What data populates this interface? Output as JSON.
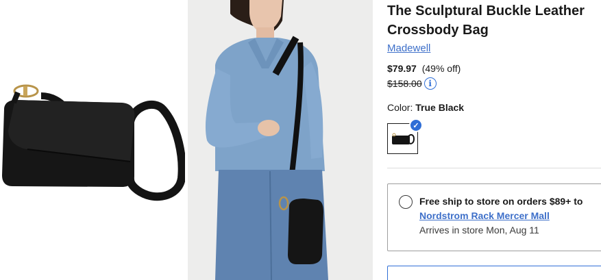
{
  "product": {
    "title": "The Sculptural Buckle Leather Crossbody Bag",
    "brand": "Madewell",
    "price": "$79.97",
    "discount": "(49% off)",
    "original_price": "$158.00",
    "color_label": "Color:",
    "color_value": "True Black"
  },
  "shipping": {
    "option_title": "Free ship to store on orders $89+ to",
    "store_name": "Nordstrom Rack Mercer Mall",
    "arrival": "Arrives in store Mon, Aug 11"
  },
  "icons": {
    "info": "info-icon",
    "check": "checkmark-icon"
  },
  "colors": {
    "accent": "#2f6ed6",
    "link": "#3d6fc9",
    "text": "#191919"
  }
}
